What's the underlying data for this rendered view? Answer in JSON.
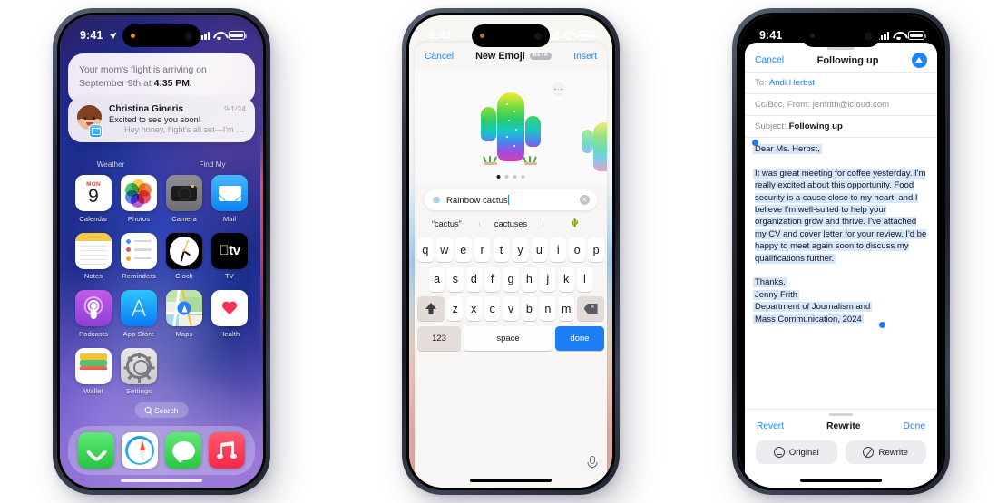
{
  "phones": {
    "home": {
      "status": {
        "time": "9:41",
        "location_icon": "location-arrow-icon",
        "signal_icon": "cellular-signal-icon",
        "wifi_icon": "wifi-icon",
        "battery_icon": "battery-icon"
      },
      "notification": {
        "summary_prefix": "Your mom's flight is arriving on September 9th at ",
        "summary_time": "4:35 PM.",
        "sender": "Christina Gineris",
        "date": "9/1/24",
        "subject": "Excited to see you soon!",
        "preview": "Hey honey, flight's all set—I'm takin...",
        "app_badge_icon": "mail-badge-icon",
        "avatar_icon": "memoji-avatar"
      },
      "widgets": [
        {
          "label": "Weather"
        },
        {
          "label": "Find My"
        }
      ],
      "apps": [
        {
          "label": "Calendar",
          "icon": "calendar-icon",
          "month": "MON",
          "day": "9"
        },
        {
          "label": "Photos",
          "icon": "photos-icon"
        },
        {
          "label": "Camera",
          "icon": "camera-icon"
        },
        {
          "label": "Mail",
          "icon": "mail-icon"
        },
        {
          "label": "Notes",
          "icon": "notes-icon"
        },
        {
          "label": "Reminders",
          "icon": "reminders-icon"
        },
        {
          "label": "Clock",
          "icon": "clock-icon"
        },
        {
          "label": "TV",
          "icon": "tv-icon",
          "wordmark": "tv"
        },
        {
          "label": "Podcasts",
          "icon": "podcasts-icon"
        },
        {
          "label": "App Store",
          "icon": "app-store-icon",
          "glyph": "A"
        },
        {
          "label": "Maps",
          "icon": "maps-icon"
        },
        {
          "label": "Health",
          "icon": "health-icon"
        },
        {
          "label": "Wallet",
          "icon": "wallet-icon"
        },
        {
          "label": "Settings",
          "icon": "settings-icon"
        }
      ],
      "search": {
        "label": "Search",
        "icon": "magnifier-icon"
      },
      "dock": [
        {
          "label": "Phone",
          "icon": "phone-icon"
        },
        {
          "label": "Safari",
          "icon": "safari-icon"
        },
        {
          "label": "Messages",
          "icon": "messages-icon"
        },
        {
          "label": "Music",
          "icon": "music-icon"
        }
      ]
    },
    "emoji": {
      "status": {
        "time": "9:41"
      },
      "navbar": {
        "cancel": "Cancel",
        "title": "New Emoji",
        "badge": "BETA",
        "insert": "Insert"
      },
      "stage": {
        "more_icon": "more-options-icon",
        "emoji_icon": "rainbow-cactus-emoji",
        "pages": 4,
        "active_page": 0
      },
      "search": {
        "value": "Rainbow cactus",
        "icon": "image-playground-icon",
        "clear_icon": "clear-icon"
      },
      "suggestions": [
        "“cactus”",
        "cactuses",
        "🌵"
      ],
      "keyboard": {
        "row1": [
          "q",
          "w",
          "e",
          "r",
          "t",
          "y",
          "u",
          "i",
          "o",
          "p"
        ],
        "row2": [
          "a",
          "s",
          "d",
          "f",
          "g",
          "h",
          "j",
          "k",
          "l"
        ],
        "row3": [
          "z",
          "x",
          "c",
          "v",
          "b",
          "n",
          "m"
        ],
        "shift_icon": "shift-icon",
        "backspace_icon": "backspace-icon",
        "numbers": "123",
        "space": "space",
        "done": "done",
        "mic_icon": "microphone-icon"
      }
    },
    "mail": {
      "status": {
        "time": "9:41"
      },
      "navbar": {
        "cancel": "Cancel",
        "title": "Following up",
        "send_icon": "send-icon"
      },
      "fields": {
        "to_label": "To:",
        "to_value": "Andi Herbst",
        "ccbcc_label": "Cc/Bcc, From:",
        "ccbcc_value": "jenfrith@icloud.com",
        "subject_label": "Subject:",
        "subject_value": "Following up"
      },
      "body": {
        "greeting": "Dear Ms. Herbst,",
        "paragraph": "It was great meeting for coffee yesterday. I'm really excited about this opportunity. Food security is a cause close to my heart, and I believe I'm well-suited to help your organization grow and thrive. I've attached my CV and cover letter for your review. I'd be happy to meet again soon to discuss my qualifications further.",
        "signoff": "Thanks,",
        "name": "Jenny Frith",
        "dept_line1": "Department of Journalism and",
        "dept_line2": "Mass Communication, 2024"
      },
      "rewrite": {
        "revert": "Revert",
        "title": "Rewrite",
        "done": "Done",
        "original_button": "Original",
        "original_icon": "history-icon",
        "rewrite_button": "Rewrite",
        "rewrite_icon": "wand-icon"
      }
    }
  },
  "colors": {
    "accent_blue": "#1b84fb",
    "selection": "#d6e6fb",
    "badge_gray": "#b9b9bf"
  }
}
